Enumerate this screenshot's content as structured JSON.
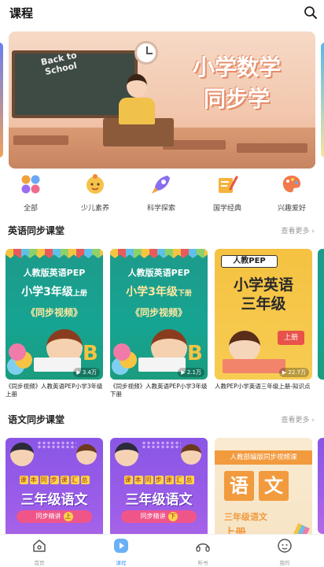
{
  "header": {
    "title": "课程"
  },
  "banner": {
    "headline_line1": "小学数学",
    "headline_line2": "同步学",
    "board_line1": "Back to",
    "board_line2": "School"
  },
  "categories": [
    {
      "label": "全部",
      "icon": "grid-icon"
    },
    {
      "label": "少儿素养",
      "icon": "child-face-icon"
    },
    {
      "label": "科学探索",
      "icon": "rocket-icon"
    },
    {
      "label": "国学经典",
      "icon": "brush-book-icon"
    },
    {
      "label": "兴趣爱好",
      "icon": "palette-icon"
    }
  ],
  "english_section": {
    "title": "英语同步课堂",
    "more": "查看更多",
    "cards": [
      {
        "line1": "人教版英语PEP",
        "line2_main": "小学3年级",
        "line2_vol": "上册",
        "line3": "《同步视频》",
        "views": "3.4万",
        "caption": "《同步视频》人教英语PEP小学3年级上册"
      },
      {
        "line1": "人教版英语PEP",
        "line2_main": "小学3年级",
        "line2_vol": "下册",
        "line3": "《同步视频》",
        "views": "2.1万",
        "caption": "《同步视频》人教英语PEP小学3年级下册"
      },
      {
        "tag": "人教PEP",
        "big1": "小学英语",
        "big2": "三年级",
        "vol": "上册",
        "views": "22.7万",
        "caption": "人教PEP小学英语三年级上册-知识点"
      }
    ]
  },
  "chinese_section": {
    "title": "语文同步课堂",
    "more": "查看更多",
    "cards": [
      {
        "chars": [
          "课",
          "本",
          "同",
          "步",
          "课",
          "汇",
          "总"
        ],
        "main": "三年级语文",
        "pill": "同步精讲",
        "vol": "上"
      },
      {
        "chars": [
          "课",
          "本",
          "同",
          "步",
          "课",
          "汇",
          "总"
        ],
        "main": "三年级语文",
        "pill": "同步精讲",
        "vol": "下"
      },
      {
        "bar": "人教部编版同步视频课",
        "block1": "语",
        "block2": "文",
        "grade": "三年级语文",
        "vol": "上册"
      }
    ]
  },
  "bottom_nav": [
    {
      "label": "首页",
      "icon": "home-icon",
      "active": false
    },
    {
      "label": "课程",
      "icon": "course-play-icon",
      "active": true
    },
    {
      "label": "听书",
      "icon": "headphones-icon",
      "active": false
    },
    {
      "label": "我的",
      "icon": "profile-icon",
      "active": false
    }
  ],
  "colors": {
    "accent": "#4a9af5",
    "muted": "#999999"
  }
}
